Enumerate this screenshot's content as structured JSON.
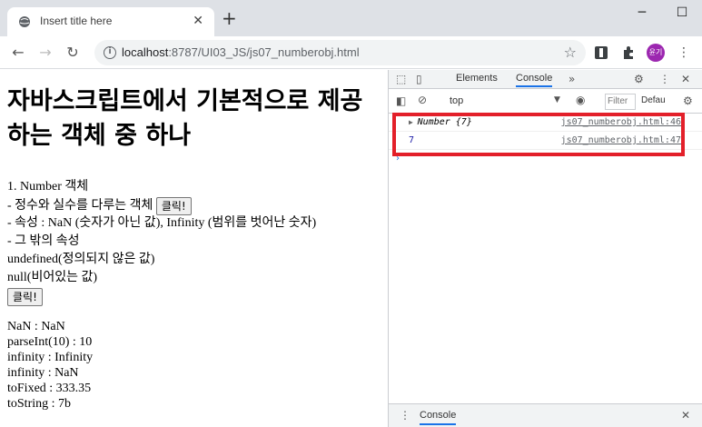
{
  "browser": {
    "tab_title": "Insert title here",
    "url_host": "localhost",
    "url_rest": ":8787/UI03_JS/js07_numberobj.html",
    "profile_label": "윤기"
  },
  "page": {
    "heading": "자바스크립트에서 기본적으로 제공하는 객체 중 하나",
    "lines": [
      "1. Number 객체",
      "- 정수와 실수를 다루는 객체",
      "- 속성 : NaN (숫자가 아닌 값), Infinity (범위를 벗어난 숫자)",
      "- 그 밖의 속성",
      "undefined(정의되지 않은 값)",
      "null(비어있는 값)"
    ],
    "button1_label": "클릭!",
    "button2_label": "클릭!",
    "output": [
      "NaN : NaN",
      "parseInt(10) : 10",
      "infinity : Infinity",
      "infinity : NaN",
      "toFixed : 333.35",
      "toString : 7b"
    ]
  },
  "devtools": {
    "tabs": [
      "Elements",
      "Console"
    ],
    "active_tab": "Console",
    "context": "top",
    "filter_placeholder": "Filter",
    "levels": "Defau",
    "console_rows": [
      {
        "value": "Number {7}",
        "source": "js07_numberobj.html:46",
        "color": "#202124"
      },
      {
        "value": "7",
        "source": "js07_numberobj.html:47",
        "color": "#1a1aa6"
      }
    ],
    "drawer_label": "Console"
  },
  "colors": {
    "highlight": "#e3202a",
    "accent": "#1a73e8"
  }
}
